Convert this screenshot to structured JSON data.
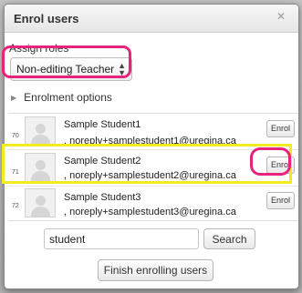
{
  "dialog": {
    "title": "Enrol users",
    "close_icon": "close-icon"
  },
  "assign_roles": {
    "label": "Assign roles",
    "selected": "Non-editing Teacher"
  },
  "enrolment_options": {
    "label": "Enrolment options"
  },
  "users": [
    {
      "num": "70",
      "name": "Sample Student1",
      "email": ", noreply+samplestudent1@uregina.ca",
      "button": "Enrol"
    },
    {
      "num": "71",
      "name": "Sample Student2",
      "email": ", noreply+samplestudent2@uregina.ca",
      "button": "Enrol"
    },
    {
      "num": "72",
      "name": "Sample Student3",
      "email": ", noreply+samplestudent3@uregina.ca",
      "button": "Enrol"
    }
  ],
  "search": {
    "value": "student",
    "button": "Search"
  },
  "finish": {
    "button": "Finish enrolling users"
  },
  "colors": {
    "highlight_pink": "#e8237b",
    "highlight_yellow": "#f2ec1f"
  }
}
